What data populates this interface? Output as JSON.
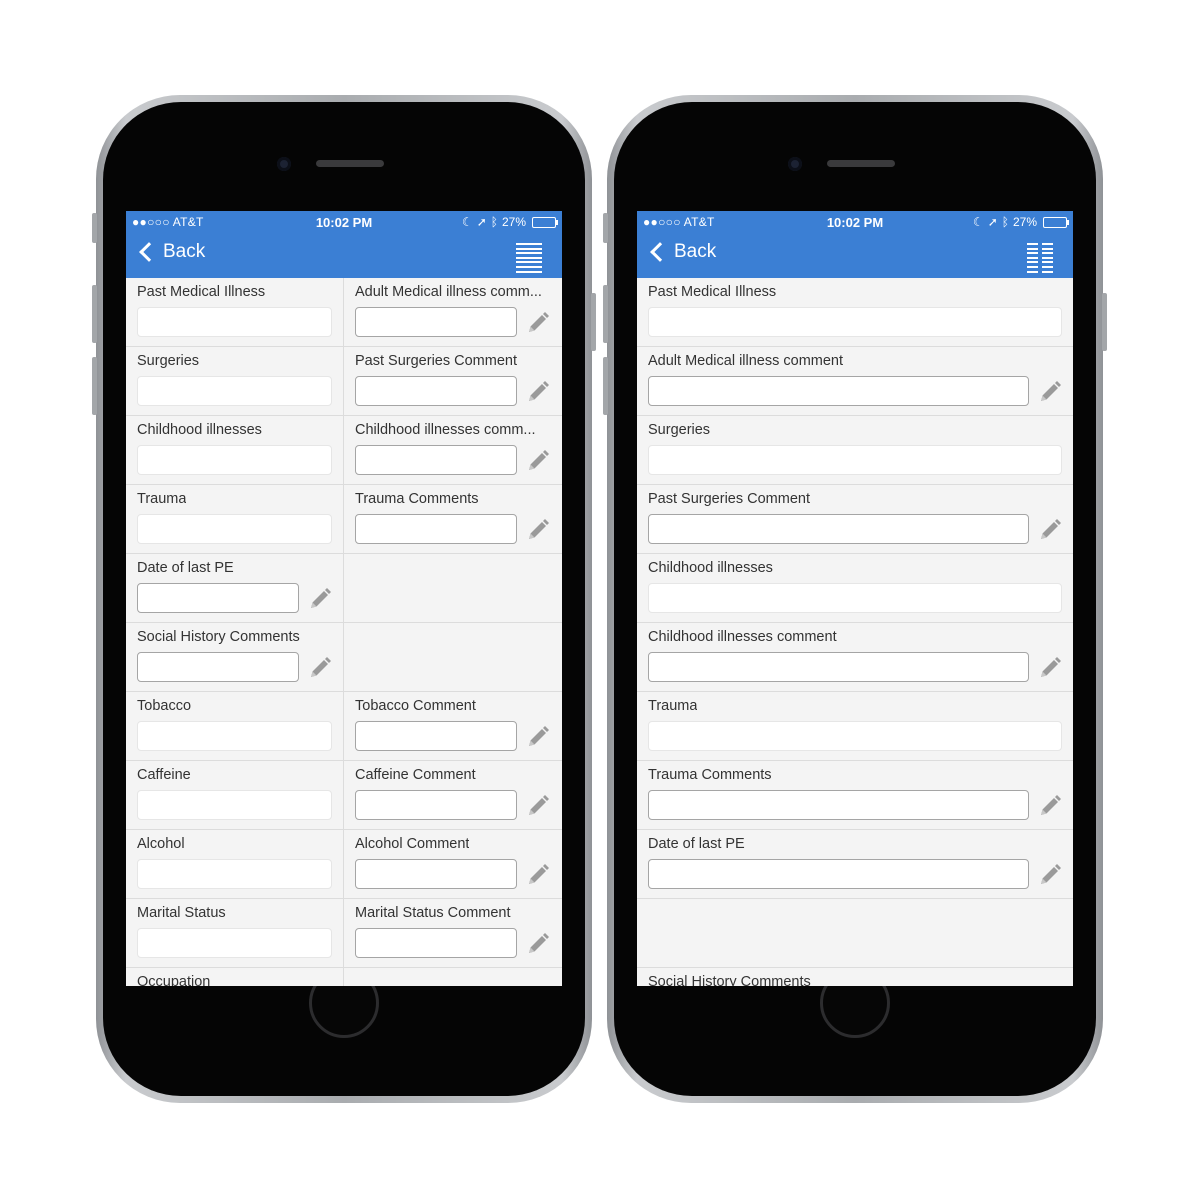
{
  "status_bar": {
    "carrier": "●●○○○ AT&T",
    "time": "10:02 PM",
    "battery": "27%",
    "battery_level": 0.27
  },
  "nav": {
    "back_label": "Back"
  },
  "left_phone": {
    "rows": [
      {
        "left": "Past Medical Illness",
        "right": "Adult Medical illness comm..."
      },
      {
        "left": "Surgeries",
        "right": "Past Surgeries Comment"
      },
      {
        "left": "Childhood illnesses",
        "right": "Childhood illnesses comm..."
      },
      {
        "left": "Trauma",
        "right": "Trauma Comments"
      },
      {
        "left": "Date of last PE",
        "right": ""
      },
      {
        "left": "Social History Comments",
        "right": ""
      },
      {
        "left": "Tobacco",
        "right": "Tobacco Comment"
      },
      {
        "left": "Caffeine",
        "right": "Caffeine Comment"
      },
      {
        "left": "Alcohol",
        "right": "Alcohol Comment"
      },
      {
        "left": "Marital Status",
        "right": "Marital Status Comment"
      },
      {
        "left": "Occupation",
        "right": ""
      }
    ]
  },
  "right_phone": {
    "rows": [
      "Past Medical Illness",
      "Adult Medical illness comment",
      "Surgeries",
      "Past Surgeries Comment",
      "Childhood illnesses",
      "Childhood illnesses comment",
      "Trauma",
      "Trauma Comments",
      "Date of last PE",
      "",
      "Social History Comments"
    ]
  }
}
